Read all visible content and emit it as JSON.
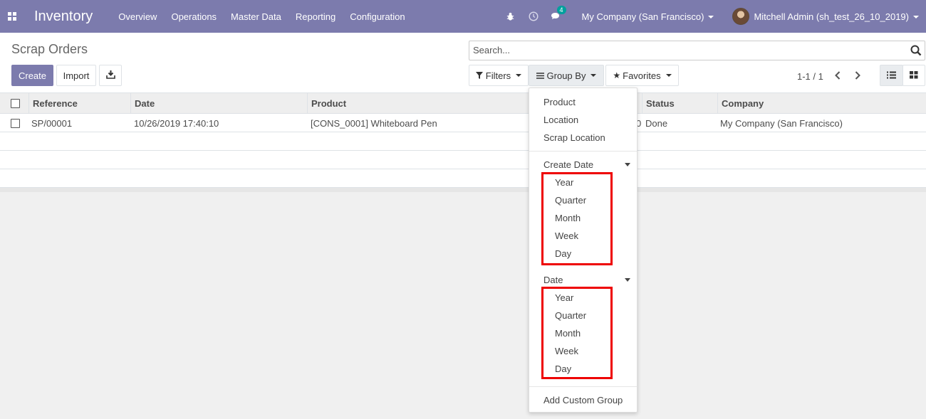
{
  "navbar": {
    "brand": "Inventory",
    "menu": [
      "Overview",
      "Operations",
      "Master Data",
      "Reporting",
      "Configuration"
    ],
    "chat_badge": "4",
    "company": "My Company (San Francisco)",
    "user": "Mitchell Admin (sh_test_26_10_2019)",
    "bg_color": "#7c7bad"
  },
  "control_panel": {
    "title": "Scrap Orders",
    "create_label": "Create",
    "import_label": "Import",
    "search_placeholder": "Search...",
    "filters_label": "Filters",
    "groupby_label": "Group By",
    "favorites_label": "Favorites",
    "pager": "1-1 / 1"
  },
  "table": {
    "columns": [
      "Reference",
      "Date",
      "Product",
      "Status",
      "Company"
    ],
    "rows": [
      {
        "reference": "SP/00001",
        "date": "10/26/2019 17:40:10",
        "product": "[CONS_0001] Whiteboard Pen",
        "qty_partial": "0",
        "status": "Done",
        "company": "My Company (San Francisco)"
      }
    ]
  },
  "groupby_menu": {
    "items": [
      "Product",
      "Location",
      "Scrap Location"
    ],
    "create_date": {
      "label": "Create Date",
      "options": [
        "Year",
        "Quarter",
        "Month",
        "Week",
        "Day"
      ]
    },
    "date": {
      "label": "Date",
      "options": [
        "Year",
        "Quarter",
        "Month",
        "Week",
        "Day"
      ]
    },
    "custom_label": "Add Custom Group"
  },
  "colors": {
    "accent": "#7c7bad",
    "highlight": "#ee0000"
  }
}
